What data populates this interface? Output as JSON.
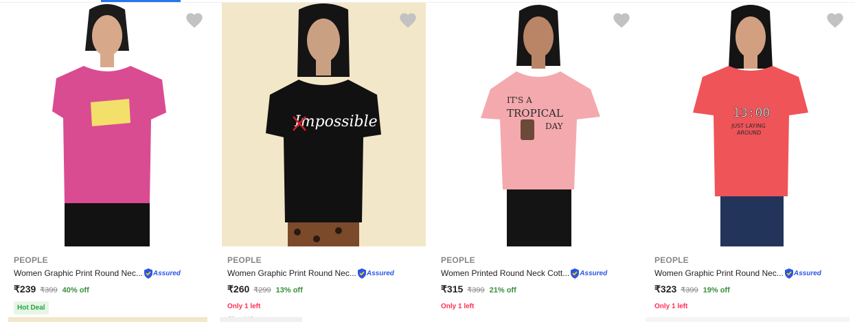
{
  "products": [
    {
      "brand": "PEOPLE",
      "title": "Women Graphic Print Round Nec...",
      "assured": "Assured",
      "price": "₹239",
      "mrp": "₹399",
      "discount": "40% off",
      "tag": "Hot Deal",
      "shirt_color": "#d94c91",
      "image_alt": "pink graphic tee"
    },
    {
      "brand": "PEOPLE",
      "title": "Women Graphic Print Round Nec...",
      "assured": "Assured",
      "price": "₹260",
      "mrp": "₹299",
      "discount": "13% off",
      "stock": "Only 1 left",
      "size": "Size XS",
      "shirt_color": "#111111",
      "print_text": "Impossible"
    },
    {
      "brand": "PEOPLE",
      "title": "Women Printed Round Neck Cott...",
      "assured": "Assured",
      "price": "₹315",
      "mrp": "₹399",
      "discount": "21% off",
      "stock": "Only 1 left",
      "shirt_color": "#f4a9ae",
      "print_lines": [
        "IT'S A",
        "TROPICAL",
        "DAY"
      ]
    },
    {
      "brand": "PEOPLE",
      "title": "Women Graphic Print Round Nec...",
      "assured": "Assured",
      "price": "₹323",
      "mrp": "₹399",
      "discount": "19% off",
      "stock": "Only 1 left",
      "shirt_color": "#ef5458",
      "print_lines": [
        "13:00",
        "JUST LAYING",
        "AROUND"
      ]
    }
  ],
  "colors": {
    "accent": "#2874f0",
    "discount_green": "#388e3c",
    "stock_red": "#ff2d55",
    "hot_deal_bg": "#e6f6e6",
    "wishlist_grey": "#c2c2c2"
  },
  "icons": [
    "heart-icon",
    "assured-shield-icon"
  ]
}
